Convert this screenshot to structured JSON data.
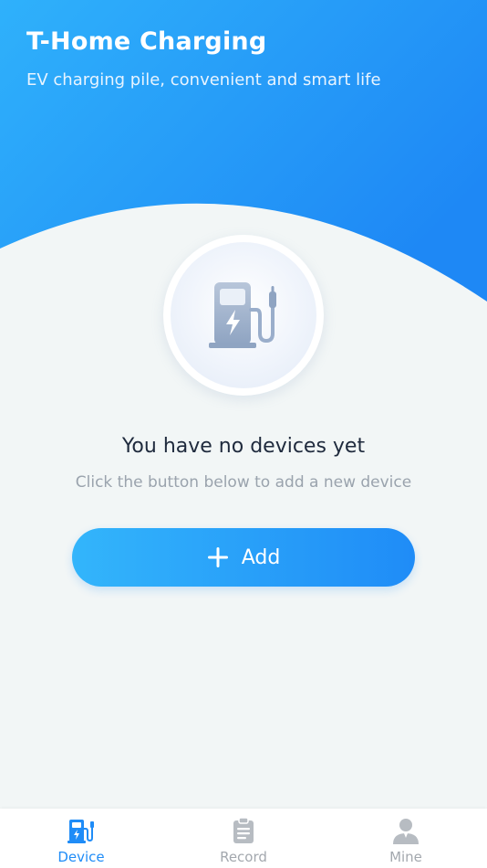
{
  "header": {
    "title": "T-Home Charging",
    "subtitle": "EV charging pile, convenient and smart life"
  },
  "empty_state": {
    "icon": "charging-pump-icon",
    "title": "You have no devices yet",
    "hint": "Click the button below to add a new device"
  },
  "add_button": {
    "icon": "plus-icon",
    "label": "Add"
  },
  "tabbar": {
    "tabs": [
      {
        "label": "Device",
        "icon": "charging-pile-icon",
        "active": true
      },
      {
        "label": "Record",
        "icon": "clipboard-icon",
        "active": false
      },
      {
        "label": "Mine",
        "icon": "person-icon",
        "active": false
      }
    ]
  },
  "colors": {
    "brand_blue": "#1f8cf7",
    "brand_light_blue": "#33b5fb",
    "background": "#f2f6f6",
    "inactive_tab": "#a3a8ae"
  }
}
